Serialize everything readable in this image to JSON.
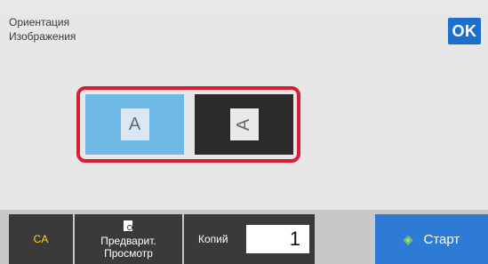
{
  "header": {
    "title_line1": "Ориентация",
    "title_line2": "Изображения",
    "ok_label": "OK"
  },
  "orientation": {
    "portrait_glyph": "A",
    "landscape_glyph": "A",
    "selected": "portrait"
  },
  "footer": {
    "ca_label": "CA",
    "preview_line1": "Предварит.",
    "preview_line2": "Просмотр",
    "copies_label": "Копий",
    "copies_value": "1",
    "start_label": "Старт"
  },
  "icons": {
    "ok": "ok-icon",
    "preview": "magnifier-document-icon",
    "start": "diamond-start-icon"
  },
  "colors": {
    "accent": "#2e7bd6",
    "selected_option": "#6fb9e6",
    "highlight_frame": "#d61f35",
    "ca_text": "#ffd800",
    "start_icon": "#9be36b"
  }
}
